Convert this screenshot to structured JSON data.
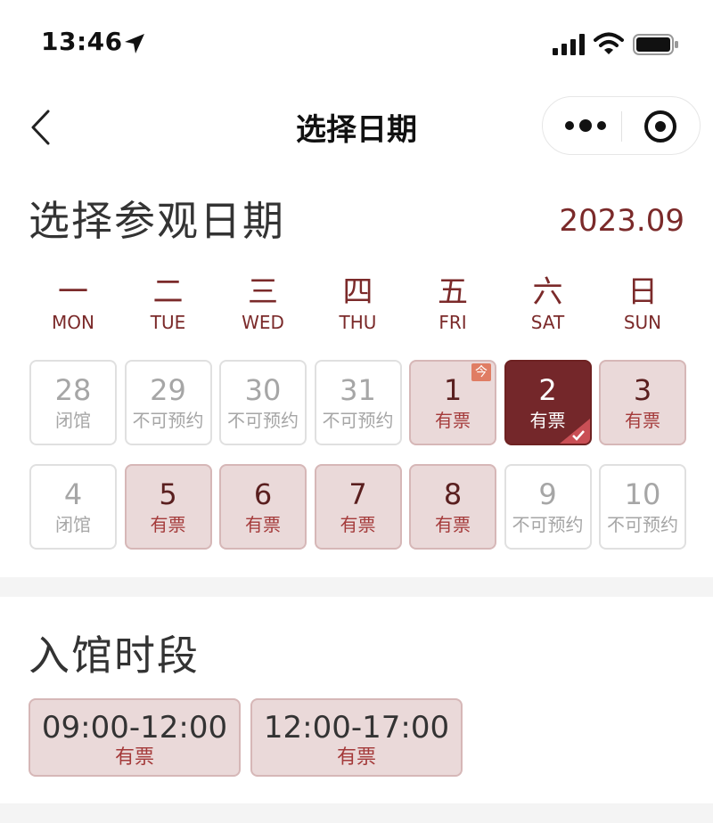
{
  "status_bar": {
    "time": "13:46",
    "icons": [
      "location-arrow-icon",
      "signal-icon",
      "wifi-icon",
      "battery-icon"
    ]
  },
  "nav": {
    "title": "选择日期",
    "back_icon": "chevron-left-icon",
    "more_icon": "more-dots-icon",
    "close_icon": "target-circle-icon"
  },
  "calendar": {
    "title": "选择参观日期",
    "month": "2023.09",
    "weekdays": [
      {
        "cn": "一",
        "en": "MON"
      },
      {
        "cn": "二",
        "en": "TUE"
      },
      {
        "cn": "三",
        "en": "WED"
      },
      {
        "cn": "四",
        "en": "THU"
      },
      {
        "cn": "五",
        "en": "FRI"
      },
      {
        "cn": "六",
        "en": "SAT"
      },
      {
        "cn": "日",
        "en": "SUN"
      }
    ],
    "today_badge": "今",
    "days": [
      {
        "num": "28",
        "status": "闭馆",
        "state": "off"
      },
      {
        "num": "29",
        "status": "不可预约",
        "state": "off"
      },
      {
        "num": "30",
        "status": "不可预约",
        "state": "off"
      },
      {
        "num": "31",
        "status": "不可预约",
        "state": "off"
      },
      {
        "num": "1",
        "status": "有票",
        "state": "avail",
        "today": true
      },
      {
        "num": "2",
        "status": "有票",
        "state": "selected"
      },
      {
        "num": "3",
        "status": "有票",
        "state": "avail"
      },
      {
        "num": "4",
        "status": "闭馆",
        "state": "off"
      },
      {
        "num": "5",
        "status": "有票",
        "state": "avail"
      },
      {
        "num": "6",
        "status": "有票",
        "state": "avail"
      },
      {
        "num": "7",
        "status": "有票",
        "state": "avail"
      },
      {
        "num": "8",
        "status": "有票",
        "state": "avail"
      },
      {
        "num": "9",
        "status": "不可预约",
        "state": "off"
      },
      {
        "num": "10",
        "status": "不可预约",
        "state": "off"
      }
    ]
  },
  "time_slots": {
    "title": "入馆时段",
    "slots": [
      {
        "range": "09:00-12:00",
        "status": "有票"
      },
      {
        "range": "12:00-17:00",
        "status": "有票"
      }
    ]
  },
  "colors": {
    "accent": "#7b2a2a",
    "selected_bg": "#74272a",
    "available_bg": "#ead9d9",
    "available_text": "#a43a3a",
    "today_badge": "#e07d64",
    "disabled_text": "#a6a6a6"
  }
}
